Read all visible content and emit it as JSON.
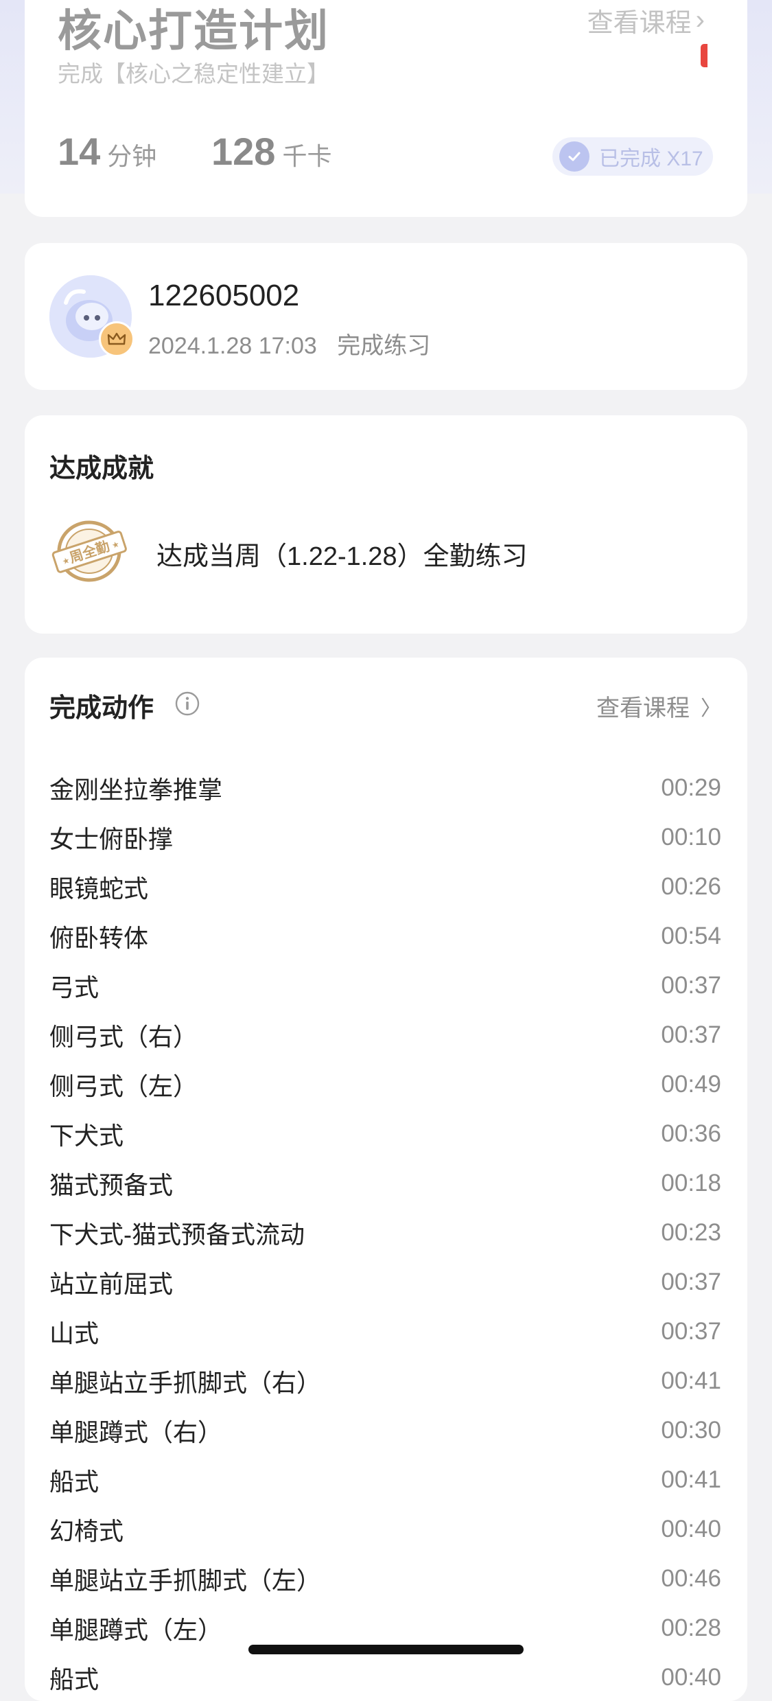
{
  "plan": {
    "title": "核心打造计划",
    "view_course": "查看课程",
    "subtitle": "完成【核心之稳定性建立】",
    "duration_value": "14",
    "duration_unit": "分钟",
    "calories_value": "128",
    "calories_unit": "千卡",
    "completed_badge": "已完成 X17"
  },
  "user": {
    "id": "122605002",
    "date": "2024.1.28 17:03",
    "status": "完成练习"
  },
  "achievement": {
    "title": "达成成就",
    "medal_text": "周全勤",
    "text": "达成当周（1.22-1.28）全勤练习"
  },
  "actions": {
    "title": "完成动作",
    "view_course": "查看课程",
    "items": [
      {
        "name": "金刚坐拉拳推掌",
        "time": "00:29"
      },
      {
        "name": "女士俯卧撑",
        "time": "00:10"
      },
      {
        "name": "眼镜蛇式",
        "time": "00:26"
      },
      {
        "name": "俯卧转体",
        "time": "00:54"
      },
      {
        "name": "弓式",
        "time": "00:37"
      },
      {
        "name": "侧弓式（右）",
        "time": "00:37"
      },
      {
        "name": "侧弓式（左）",
        "time": "00:49"
      },
      {
        "name": "下犬式",
        "time": "00:36"
      },
      {
        "name": "猫式预备式",
        "time": "00:18"
      },
      {
        "name": "下犬式-猫式预备式流动",
        "time": "00:23"
      },
      {
        "name": "站立前屈式",
        "time": "00:37"
      },
      {
        "name": "山式",
        "time": "00:37"
      },
      {
        "name": "单腿站立手抓脚式（右）",
        "time": "00:41"
      },
      {
        "name": "单腿蹲式（右）",
        "time": "00:30"
      },
      {
        "name": "船式",
        "time": "00:41"
      },
      {
        "name": "幻椅式",
        "time": "00:40"
      },
      {
        "name": "单腿站立手抓脚式（左）",
        "time": "00:46"
      },
      {
        "name": "单腿蹲式（左）",
        "time": "00:28"
      },
      {
        "name": "船式",
        "time": "00:40"
      }
    ]
  },
  "colors": {
    "accent": "#bcc4f0",
    "medal": "#c9a36a",
    "crown": "#f7c47b",
    "red_marker": "#e8463f"
  }
}
